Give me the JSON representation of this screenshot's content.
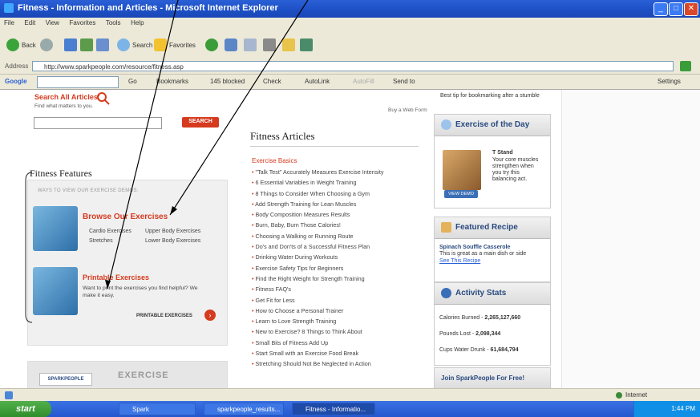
{
  "window": {
    "title": "Fitness - Information and Articles - Microsoft Internet Explorer",
    "buttons": {
      "minimize": "_",
      "maximize": "□",
      "close": "✕"
    }
  },
  "menu": [
    "File",
    "Edit",
    "View",
    "Favorites",
    "Tools",
    "Help"
  ],
  "toolbar": {
    "back": "Back",
    "search": "Search",
    "favorites": "Favorites"
  },
  "address": {
    "label": "Address",
    "url": "http://www.sparkpeople.com/resource/fitness.asp"
  },
  "google_bar": {
    "logo": "Google",
    "items": [
      "Go",
      "Bookmarks",
      "145 blocked",
      "Check",
      "AutoLink",
      "AutoFill",
      "Send to"
    ],
    "settings": "Settings"
  },
  "left": {
    "search_title": "Search All Articles:",
    "search_hint": "Find what matters to you.",
    "search_button": "SEARCH",
    "features_title": "Fitness Features",
    "ways_title": "WAYS TO VIEW OUR EXERCISE DEMOS:",
    "browse_title": "Browse Our Exercises",
    "browse_links": [
      "Cardio Exercises",
      "Upper Body Exercises",
      "Stretches",
      "Lower Body Exercises"
    ],
    "printable_title": "Printable Exercises",
    "printable_desc": "Want to print the exercises you find helpful? We make it easy.",
    "printable_link": "PRINTABLE EXERCISES",
    "logo_spark": "SPARKPEOPLE",
    "logo_exercise": "EXERCISE"
  },
  "middle": {
    "top_link": "Buy a Web Form",
    "title": "Fitness Articles",
    "section": "Exercise Basics",
    "articles": [
      "\"Talk Test\" Accurately Measures Exercise Intensity",
      "6 Essential Variables in Weight Training",
      "8 Things to Consider When Choosing a Gym",
      "Add Strength Training for Lean Muscles",
      "Body Composition Measures Results",
      "Burn, Baby, Burn Those Calories!",
      "Choosing a Walking or Running Route",
      "Do's and Don'ts of a Successful Fitness Plan",
      "Drinking Water During Workouts",
      "Exercise Safety Tips for Beginners",
      "Find the Right Weight for Strength Training",
      "Fitness FAQ's",
      "Get Fit for Less",
      "How to Choose a Personal Trainer",
      "Learn to Love Strength Training",
      "New to Exercise? 8 Things to Think About",
      "Small Bits of Fitness Add Up",
      "Start Small with an Exercise Food Break",
      "Stretching Should Not Be Neglected in Action"
    ]
  },
  "right": {
    "top_text": "Best tip for bookmarking after a stumble",
    "exercise_day_title": "Exercise of the Day",
    "exercise_name": "T Stand",
    "exercise_desc": "Your core muscles strengthen when you try this balancing act.",
    "view_demo": "VIEW DEMO",
    "recipe_title": "Featured Recipe",
    "recipe_name": "Spinach Souffle Casserole",
    "recipe_desc": "This is great as a main dish or side",
    "recipe_link": "See This Recipe",
    "activity_title": "Activity Stats",
    "stats": [
      {
        "label": "Calories Burned -",
        "value": "2,265,127,660"
      },
      {
        "label": "Pounds Lost -",
        "value": "2,098,344"
      },
      {
        "label": "Cups Water Drunk -",
        "value": "61,684,794"
      }
    ],
    "join": "Join SparkPeople For Free!"
  },
  "status": {
    "zone": "Internet"
  },
  "taskbar": {
    "start": "start",
    "tasks": [
      "Spark",
      "sparkpeople_results...",
      "Fitness - Informatio..."
    ],
    "clock": "1:44 PM"
  },
  "colors": {
    "accent_red": "#d63a1f",
    "link_blue": "#294a80",
    "xp_blue": "#2457cf"
  }
}
